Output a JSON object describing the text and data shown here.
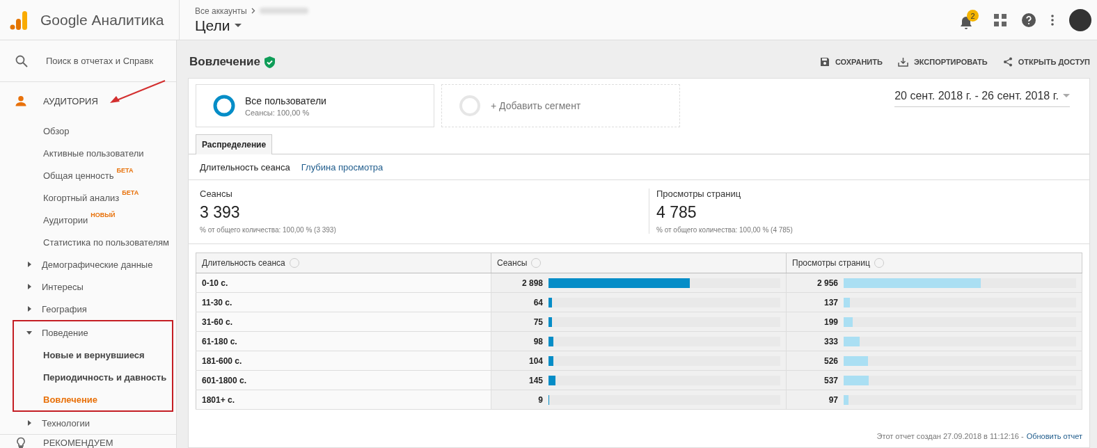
{
  "header": {
    "product": "Google Аналитика",
    "breadcrumb": "Все аккаунты",
    "view": "Цели",
    "notifications": "2"
  },
  "sidebar": {
    "search": {
      "placeholder": "Поиск в отчетах и Справк"
    },
    "sections": [
      {
        "label": "АУДИТОРИЯ",
        "active": true,
        "pointer_arrow": true,
        "items": [
          {
            "kind": "link",
            "label": "Обзор",
            "selected": false
          },
          {
            "kind": "link",
            "label": "Активные пользователи",
            "selected": false
          },
          {
            "kind": "link",
            "label": "Общая ценность",
            "badge": "БЕТА",
            "selected": false
          },
          {
            "kind": "link",
            "label": "Когортный анализ",
            "badge": "БЕТА",
            "selected": false
          },
          {
            "kind": "link",
            "label": "Аудитории",
            "badge": "НОВЫЙ",
            "selected": false
          },
          {
            "kind": "link",
            "label": "Статистика по пользователям",
            "selected": false
          },
          {
            "kind": "folder",
            "label": "Демографические данные",
            "expanded": false,
            "highlighted": false,
            "selected": false
          },
          {
            "kind": "folder",
            "label": "Интересы",
            "expanded": false,
            "highlighted": false,
            "selected": false
          },
          {
            "kind": "folder",
            "label": "География",
            "expanded": false,
            "highlighted": false,
            "selected": false
          },
          {
            "kind": "folder",
            "label": "Поведение",
            "expanded": true,
            "highlighted": true,
            "selected": false,
            "children": [
              {
                "kind": "link",
                "label": "Новые и вернувшиеся",
                "selected": false
              },
              {
                "kind": "link",
                "label": "Периодичность и давность",
                "selected": false
              },
              {
                "kind": "link",
                "label": "Вовлечение",
                "selected": true
              }
            ]
          },
          {
            "kind": "folder",
            "label": "Технологии",
            "expanded": false,
            "highlighted": false,
            "selected": false
          }
        ]
      },
      {
        "label": "РЕКОМЕНДУЕМ",
        "active": false,
        "pointer_arrow": false
      }
    ]
  },
  "report": {
    "title": "Вовлечение",
    "verified": true,
    "actions": [
      {
        "label": "СОХРАНИТЬ"
      },
      {
        "label": "ЭКСПОРТИРОВАТЬ"
      },
      {
        "label": "ОТКРЫТЬ ДОСТУП"
      }
    ],
    "segments": [
      {
        "kind": "segment",
        "name": "Все пользователи",
        "detail": "Сеансы: 100,00 %"
      },
      {
        "kind": "add",
        "name": "+ Добавить сегмент"
      }
    ],
    "date_range": "20 сент. 2018 г. - 26 сент. 2018 г.",
    "tabs": [
      {
        "label": "Распределение",
        "selected": true
      }
    ],
    "subtabs": [
      {
        "label": "Длительность сеанса",
        "selected": true
      },
      {
        "label": "Глубина просмотра",
        "selected": false
      }
    ],
    "scorecards": [
      {
        "label": "Сеансы",
        "value": "3 393",
        "detail": "% от общего количества: 100,00 % (3 393)"
      },
      {
        "label": "Просмотры страниц",
        "value": "4 785",
        "detail": "% от общего количества: 100,00 % (4 785)"
      }
    ],
    "table": {
      "columns": [
        {
          "label": "Длительность сеанса"
        },
        {
          "label": "Сеансы"
        },
        {
          "label": "Просмотры страниц"
        }
      ],
      "rows": [
        {
          "cells": [
            {
              "value": "0-10 с."
            },
            {
              "value": "2 898",
              "level": 0.61
            },
            {
              "value": "2 956",
              "level": 0.59
            }
          ]
        },
        {
          "cells": [
            {
              "value": "11-30 с."
            },
            {
              "value": "64",
              "level": 0.014
            },
            {
              "value": "137",
              "level": 0.028
            }
          ]
        },
        {
          "cells": [
            {
              "value": "31-60 с."
            },
            {
              "value": "75",
              "level": 0.016
            },
            {
              "value": "199",
              "level": 0.04
            }
          ]
        },
        {
          "cells": [
            {
              "value": "61-180 с."
            },
            {
              "value": "98",
              "level": 0.021
            },
            {
              "value": "333",
              "level": 0.068
            }
          ]
        },
        {
          "cells": [
            {
              "value": "181-600 с."
            },
            {
              "value": "104",
              "level": 0.022
            },
            {
              "value": "526",
              "level": 0.106
            }
          ]
        },
        {
          "cells": [
            {
              "value": "601-1800 с."
            },
            {
              "value": "145",
              "level": 0.031
            },
            {
              "value": "537",
              "level": 0.109
            }
          ]
        },
        {
          "cells": [
            {
              "value": "1801+ с."
            },
            {
              "value": "9",
              "level": 0.002
            },
            {
              "value": "97",
              "level": 0.02
            }
          ]
        }
      ]
    },
    "footer": {
      "text": "Этот отчет создан 27.09.2018 в 11:12:16 -",
      "link": "Обновить отчет"
    }
  }
}
